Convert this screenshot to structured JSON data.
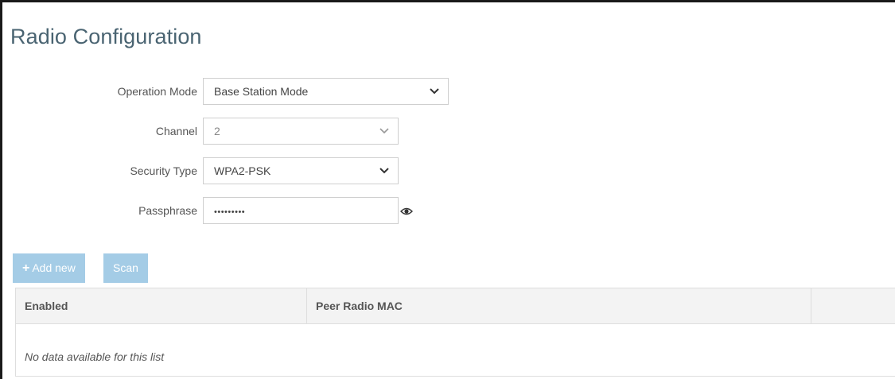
{
  "page": {
    "title": "Radio Configuration"
  },
  "form": {
    "operation_mode": {
      "label": "Operation Mode",
      "value": "Base Station Mode"
    },
    "channel": {
      "label": "Channel",
      "value": "2"
    },
    "security_type": {
      "label": "Security Type",
      "value": "WPA2-PSK"
    },
    "passphrase": {
      "label": "Passphrase",
      "value": "•••••••••"
    }
  },
  "toolbar": {
    "add_new_label": "Add new",
    "add_new_icon": "plus-icon",
    "scan_label": "Scan"
  },
  "table": {
    "columns": [
      "Enabled",
      "Peer Radio MAC",
      ""
    ],
    "empty_message": "No data available for this list"
  },
  "colors": {
    "title": "#4a6472",
    "button": "#a4cce6",
    "header_bg": "#f3f3f3",
    "border": "#dedede"
  },
  "icons": {
    "passphrase_toggle": "eye-icon",
    "dropdown": "chevron-down-icon"
  }
}
